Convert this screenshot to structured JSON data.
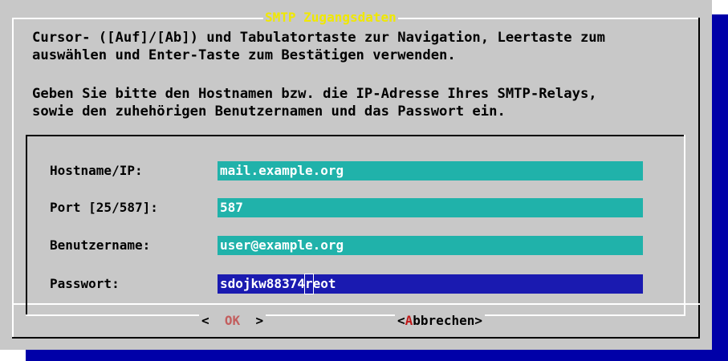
{
  "dialog": {
    "title": "SMTP Zugangsdaten",
    "help_line1": "Cursor- ([Auf]/[Ab]) und Tabulatortaste zur Navigation, Leertaste zum",
    "help_line2": "auswählen und Enter-Taste zum Bestätigen verwenden.",
    "prompt_line1": "Geben Sie bitte den Hostnamen bzw. die IP-Adresse Ihres SMTP-Relays,",
    "prompt_line2": "sowie den zuhehörigen Benutzernamen und das Passwort ein."
  },
  "form": {
    "fields": [
      {
        "label": "Hostname/IP:",
        "value": "mail.example.org"
      },
      {
        "label": "Port [25/587]:",
        "value": "587"
      },
      {
        "label": "Benutzername:",
        "value": "user@example.org"
      },
      {
        "label": "Passwort:",
        "value_before_cursor": "sdojkw88374",
        "cursor_char": "r",
        "value_after_cursor": "eot"
      }
    ]
  },
  "buttons": {
    "ok_left": "<",
    "ok_label": "OK",
    "ok_right": ">",
    "cancel_left": "<",
    "cancel_hotkey": "A",
    "cancel_rest": "bbrechen",
    "cancel_right": ">"
  },
  "colors": {
    "dialog_bg": "#c8c8c8",
    "title_text": "#f0e800",
    "input_bg": "#20b2aa",
    "active_input_bg": "#1a1ab0",
    "shadow": "#0000a8",
    "hotkey": "#c01818"
  }
}
